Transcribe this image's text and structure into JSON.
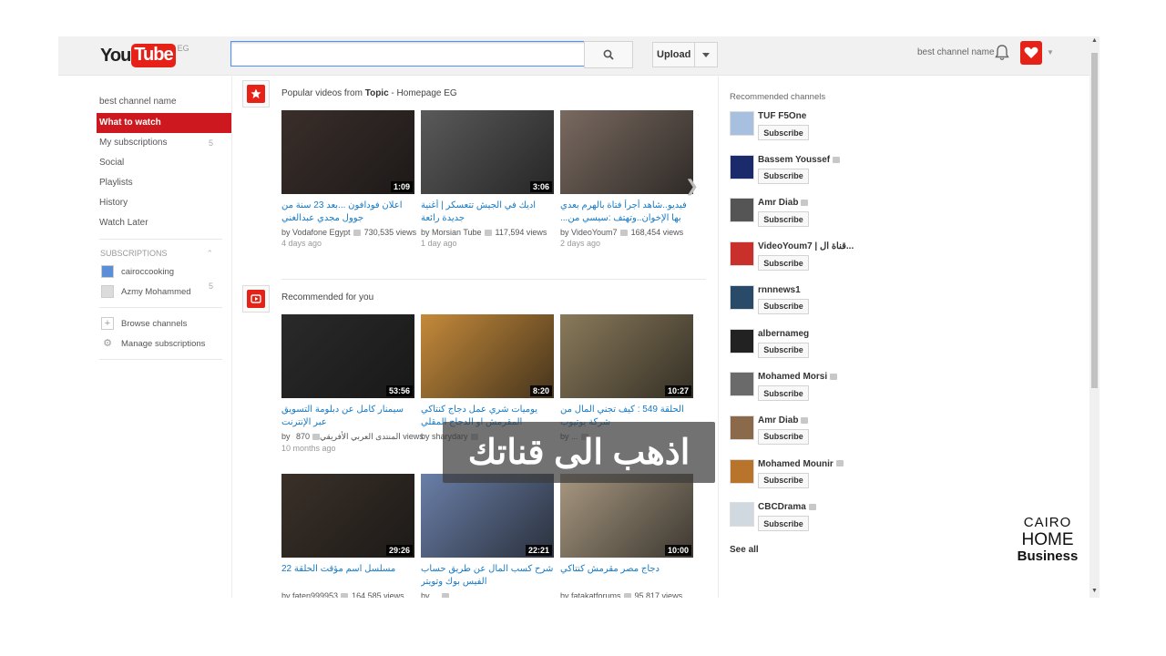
{
  "header": {
    "logo_you": "You",
    "logo_tube": "Tube",
    "logo_region": "EG",
    "search_value": "",
    "upload_label": "Upload",
    "channel_name": "best channel name"
  },
  "sidebar": {
    "title": "best channel name",
    "items": [
      {
        "label": "What to watch",
        "active": true,
        "count": ""
      },
      {
        "label": "My subscriptions",
        "active": false,
        "count": "5"
      },
      {
        "label": "Social",
        "active": false,
        "count": ""
      },
      {
        "label": "Playlists",
        "active": false,
        "count": ""
      },
      {
        "label": "History",
        "active": false,
        "count": ""
      },
      {
        "label": "Watch Later",
        "active": false,
        "count": ""
      }
    ],
    "subscriptions_label": "SUBSCRIPTIONS",
    "subscriptions": [
      {
        "label": "cairoccooking",
        "count": ""
      },
      {
        "label": "Azmy Mohammed",
        "count": "5"
      }
    ],
    "browse_channels": "Browse channels",
    "manage_subscriptions": "Manage subscriptions"
  },
  "shelves": {
    "popular": {
      "title_prefix": "Popular videos from ",
      "title_bold": "Topic",
      "title_suffix": " - Homepage EG",
      "videos": [
        {
          "duration": "1:09",
          "title": "اعلان فودافون ...بعد 23 سنة من جوول مجدي عبدالغني",
          "channel": "by Vodafone Egypt",
          "views": "730,535 views",
          "age": "4 days ago",
          "thumb": "#3a2e2a"
        },
        {
          "duration": "3:06",
          "title": "اديك في الجيش تتعسكر | أغنية جديدة رائعة",
          "channel": "by Morsian Tube",
          "views": "117,594 views",
          "age": "1 day ago",
          "thumb": "#5a5a5a"
        },
        {
          "duration": "",
          "title": "فيديو..شاهد أجرأ فتاة بالهرم بعدي بها الإخوان..وتهتف :سيسي من...",
          "channel": "by VideoYoum7",
          "views": "168,454 views",
          "age": "2 days ago",
          "thumb": "#7a6a60"
        }
      ]
    },
    "recommended": {
      "title": "Recommended for you",
      "videos": [
        {
          "duration": "53:56",
          "title": "سيمنار كامل عن دبلومة التسويق عبر الإنترنت",
          "channel": "by المنتدى العربي الأفريقي",
          "views": "870 views",
          "age": "10 months ago",
          "thumb": "#2a2a2a"
        },
        {
          "duration": "8:20",
          "title": "يوميات شري عمل دجاج كنتاكي المقرمش او الدجاج المقلي",
          "channel": "by sharydary",
          "views": "",
          "age": "",
          "thumb": "#c58a3a"
        },
        {
          "duration": "10:27",
          "title": "الحلقة 549 : كيف تجني المال من شركة يوتيوب",
          "channel": "by ...",
          "views": "",
          "age": "",
          "thumb": "#8a7a5a"
        },
        {
          "duration": "29:26",
          "title": "مسلسل اسم مؤقت الحلقة 22",
          "channel": "by faten999953",
          "views": "164,585 views",
          "age": "",
          "thumb": "#3a3028"
        },
        {
          "duration": "22:21",
          "title": "شرح كسب المال عن طريق حساب الفيس بوك وتويتر",
          "channel": "by ...",
          "views": "",
          "age": "",
          "thumb": "#6a7fa8"
        },
        {
          "duration": "10:00",
          "title": "دجاج مصر مقرمش كنتاكي",
          "channel": "by fatakatforums",
          "views": "95,817 views",
          "age": "",
          "thumb": "#a89880"
        }
      ]
    }
  },
  "overlay_text": "اذهب الى قناتك",
  "recommended_channels": {
    "title": "Recommended channels",
    "subscribe_label": "Subscribe",
    "channels": [
      {
        "name": "TUF F5One",
        "color": "#a8c0e0",
        "verified": false
      },
      {
        "name": "Bassem Youssef",
        "color": "#1a2a6a",
        "verified": true
      },
      {
        "name": "Amr Diab",
        "color": "#555555",
        "verified": true
      },
      {
        "name": "VideoYoum7 | قناة ال...",
        "color": "#c9302c",
        "verified": false
      },
      {
        "name": "rnnnews1",
        "color": "#2a4a6a",
        "verified": false
      },
      {
        "name": "albernameg",
        "color": "#222222",
        "verified": false
      },
      {
        "name": "Mohamed Morsi",
        "color": "#6a6a6a",
        "verified": true
      },
      {
        "name": "Amr Diab",
        "color": "#8a6a4a",
        "verified": true
      },
      {
        "name": "Mohamed Mounir",
        "color": "#b8742a",
        "verified": true
      },
      {
        "name": "CBCDrama",
        "color": "#d0d8e0",
        "verified": true
      }
    ],
    "see_all": "See all"
  },
  "watermark": {
    "line1": "CAIRO",
    "line2": "HOME",
    "line3": "Business"
  },
  "colors": {
    "brand_red": "#e62117",
    "active_nav": "#cc181e",
    "link_blue": "#167ac6"
  }
}
